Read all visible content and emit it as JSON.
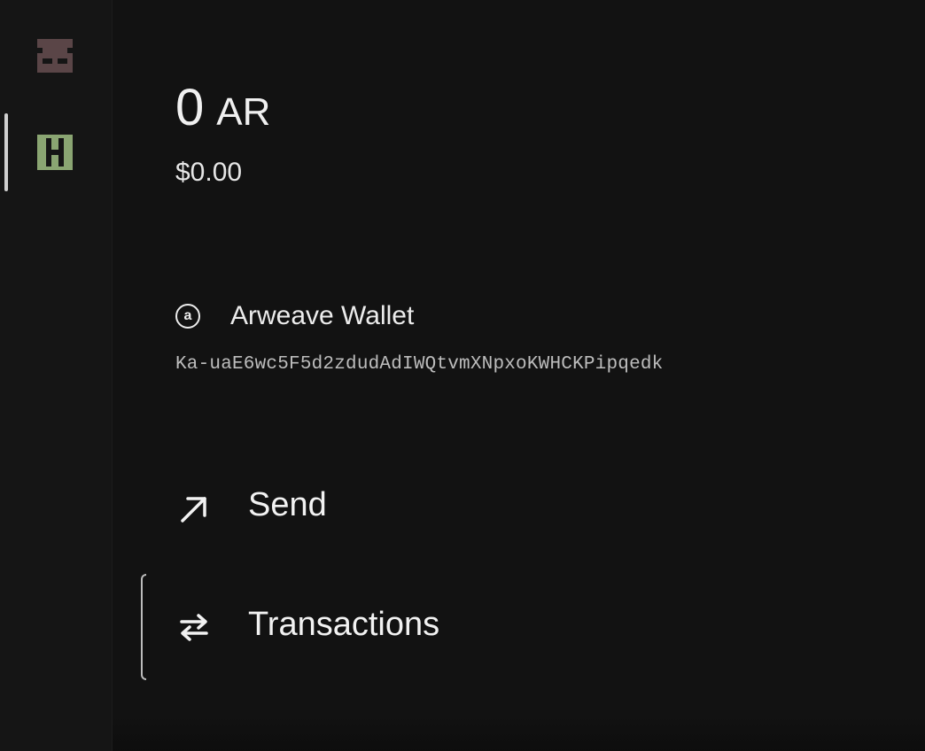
{
  "sidebar": {
    "items": [
      {
        "name": "vault-logo",
        "color": "#5a4547",
        "active": false
      },
      {
        "name": "h-logo",
        "color": "#8aa572",
        "active": true
      }
    ]
  },
  "balance": {
    "amount": "0",
    "unit": "AR",
    "fiat": "$0.00"
  },
  "wallet": {
    "icon_letter": "a",
    "name": "Arweave Wallet",
    "address": "Ka-uaE6wc5F5d2zdudAdIWQtvmXNpxoKWHCKPipqedk"
  },
  "nav": {
    "items": [
      {
        "label": "Send",
        "icon": "arrow-up-right-icon",
        "active": false
      },
      {
        "label": "Transactions",
        "icon": "swap-arrows-icon",
        "active": true
      }
    ]
  },
  "colors": {
    "background": "#121212",
    "sidebar": "#151515",
    "text": "#ececec",
    "muted": "#bdbdbd"
  }
}
